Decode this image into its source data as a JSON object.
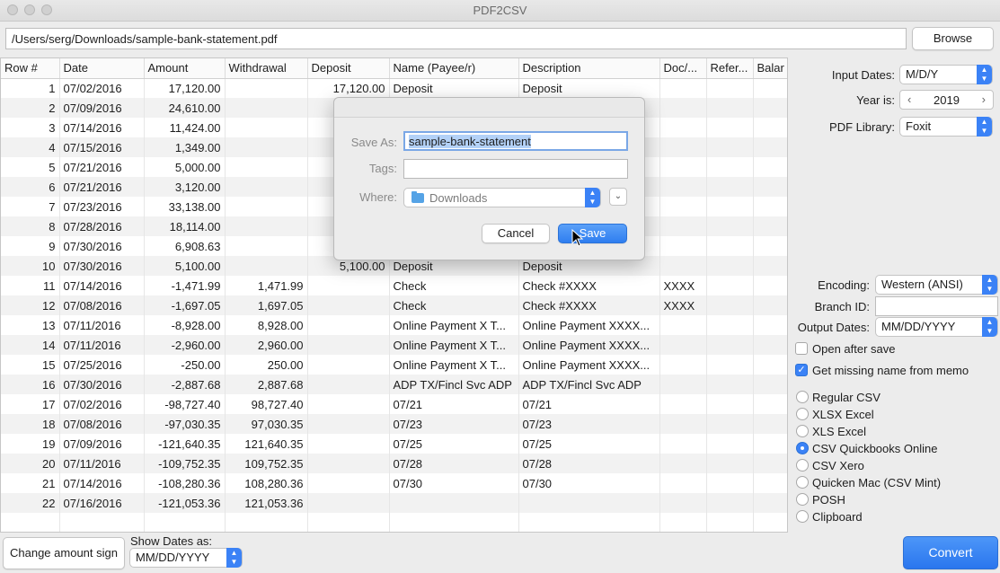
{
  "window": {
    "title": "PDF2CSV"
  },
  "file": {
    "path": "/Users/serg/Downloads/sample-bank-statement.pdf",
    "browse_label": "Browse"
  },
  "table": {
    "columns": [
      "Row #",
      "Date",
      "Amount",
      "Withdrawal",
      "Deposit",
      "Name (Payee/r)",
      "Description",
      "Doc/...",
      "Refer...",
      "Balar"
    ],
    "rows": [
      {
        "n": "1",
        "date": "07/02/2016",
        "amount": "17,120.00",
        "withdrawal": "",
        "deposit": "17,120.00",
        "name": "Deposit",
        "desc": "Deposit",
        "doc": ""
      },
      {
        "n": "2",
        "date": "07/09/2016",
        "amount": "24,610.00",
        "withdrawal": "",
        "deposit": "",
        "name": "",
        "desc": "",
        "doc": ""
      },
      {
        "n": "3",
        "date": "07/14/2016",
        "amount": "11,424.00",
        "withdrawal": "",
        "deposit": "",
        "name": "",
        "desc": "",
        "doc": ""
      },
      {
        "n": "4",
        "date": "07/15/2016",
        "amount": "1,349.00",
        "withdrawal": "",
        "deposit": "",
        "name": "",
        "desc": "",
        "doc": ""
      },
      {
        "n": "5",
        "date": "07/21/2016",
        "amount": "5,000.00",
        "withdrawal": "",
        "deposit": "",
        "name": "",
        "desc": "",
        "doc": ""
      },
      {
        "n": "6",
        "date": "07/21/2016",
        "amount": "3,120.00",
        "withdrawal": "",
        "deposit": "",
        "name": "",
        "desc": "",
        "doc": ""
      },
      {
        "n": "7",
        "date": "07/23/2016",
        "amount": "33,138.00",
        "withdrawal": "",
        "deposit": "",
        "name": "",
        "desc": "",
        "doc": ""
      },
      {
        "n": "8",
        "date": "07/28/2016",
        "amount": "18,114.00",
        "withdrawal": "",
        "deposit": "",
        "name": "",
        "desc": "",
        "doc": ""
      },
      {
        "n": "9",
        "date": "07/30/2016",
        "amount": "6,908.63",
        "withdrawal": "",
        "deposit": "",
        "name": "",
        "desc": "",
        "doc": ""
      },
      {
        "n": "10",
        "date": "07/30/2016",
        "amount": "5,100.00",
        "withdrawal": "",
        "deposit": "5,100.00",
        "name": "Deposit",
        "desc": "Deposit",
        "doc": ""
      },
      {
        "n": "11",
        "date": "07/14/2016",
        "amount": "-1,471.99",
        "withdrawal": "1,471.99",
        "deposit": "",
        "name": "Check",
        "desc": "Check #XXXX",
        "doc": "XXXX"
      },
      {
        "n": "12",
        "date": "07/08/2016",
        "amount": "-1,697.05",
        "withdrawal": "1,697.05",
        "deposit": "",
        "name": "Check",
        "desc": "Check #XXXX",
        "doc": "XXXX"
      },
      {
        "n": "13",
        "date": "07/11/2016",
        "amount": "-8,928.00",
        "withdrawal": "8,928.00",
        "deposit": "",
        "name": "Online Payment X T...",
        "desc": "Online Payment XXXX...",
        "doc": ""
      },
      {
        "n": "14",
        "date": "07/11/2016",
        "amount": "-2,960.00",
        "withdrawal": "2,960.00",
        "deposit": "",
        "name": "Online Payment X T...",
        "desc": "Online Payment XXXX...",
        "doc": ""
      },
      {
        "n": "15",
        "date": "07/25/2016",
        "amount": "-250.00",
        "withdrawal": "250.00",
        "deposit": "",
        "name": "Online Payment X T...",
        "desc": "Online Payment XXXX...",
        "doc": ""
      },
      {
        "n": "16",
        "date": "07/30/2016",
        "amount": "-2,887.68",
        "withdrawal": "2,887.68",
        "deposit": "",
        "name": "ADP TX/Fincl Svc ADP",
        "desc": "ADP TX/Fincl Svc ADP",
        "doc": ""
      },
      {
        "n": "17",
        "date": "07/02/2016",
        "amount": "-98,727.40",
        "withdrawal": "98,727.40",
        "deposit": "",
        "name": "07/21",
        "desc": "07/21",
        "doc": ""
      },
      {
        "n": "18",
        "date": "07/08/2016",
        "amount": "-97,030.35",
        "withdrawal": "97,030.35",
        "deposit": "",
        "name": "07/23",
        "desc": "07/23",
        "doc": ""
      },
      {
        "n": "19",
        "date": "07/09/2016",
        "amount": "-121,640.35",
        "withdrawal": "121,640.35",
        "deposit": "",
        "name": "07/25",
        "desc": "07/25",
        "doc": ""
      },
      {
        "n": "20",
        "date": "07/11/2016",
        "amount": "-109,752.35",
        "withdrawal": "109,752.35",
        "deposit": "",
        "name": "07/28",
        "desc": "07/28",
        "doc": ""
      },
      {
        "n": "21",
        "date": "07/14/2016",
        "amount": "-108,280.36",
        "withdrawal": "108,280.36",
        "deposit": "",
        "name": "07/30",
        "desc": "07/30",
        "doc": ""
      },
      {
        "n": "22",
        "date": "07/16/2016",
        "amount": "-121,053.36",
        "withdrawal": "121,053.36",
        "deposit": "",
        "name": "",
        "desc": "",
        "doc": ""
      }
    ]
  },
  "save_dialog": {
    "save_as_label": "Save As:",
    "save_as_value": "sample-bank-statement",
    "tags_label": "Tags:",
    "where_label": "Where:",
    "where_value": "Downloads",
    "cancel_label": "Cancel",
    "save_label": "Save"
  },
  "settings": {
    "input_dates_label": "Input Dates:",
    "input_dates_value": "M/D/Y",
    "year_label": "Year is:",
    "year_value": "2019",
    "pdf_library_label": "PDF Library:",
    "pdf_library_value": "Foxit",
    "encoding_label": "Encoding:",
    "encoding_value": "Western (ANSI)",
    "branch_id_label": "Branch ID:",
    "branch_id_value": "",
    "output_dates_label": "Output Dates:",
    "output_dates_value": "MM/DD/YYYY",
    "open_after_save_label": "Open after save",
    "open_after_save_checked": false,
    "get_missing_name_label": "Get missing name from memo",
    "get_missing_name_checked": true
  },
  "formats": [
    {
      "label": "Regular CSV",
      "selected": false
    },
    {
      "label": "XLSX Excel",
      "selected": false
    },
    {
      "label": "XLS Excel",
      "selected": false
    },
    {
      "label": "CSV Quickbooks Online",
      "selected": true
    },
    {
      "label": "CSV Xero",
      "selected": false
    },
    {
      "label": "Quicken Mac (CSV Mint)",
      "selected": false
    },
    {
      "label": "POSH",
      "selected": false
    },
    {
      "label": "Clipboard",
      "selected": false
    }
  ],
  "bottom": {
    "change_sign_label": "Change amount sign",
    "show_dates_label": "Show Dates as:",
    "show_dates_value": "MM/DD/YYYY",
    "convert_label": "Convert"
  },
  "colors": {
    "accent": "#3b82f6",
    "selection": "#b3d1f7"
  }
}
